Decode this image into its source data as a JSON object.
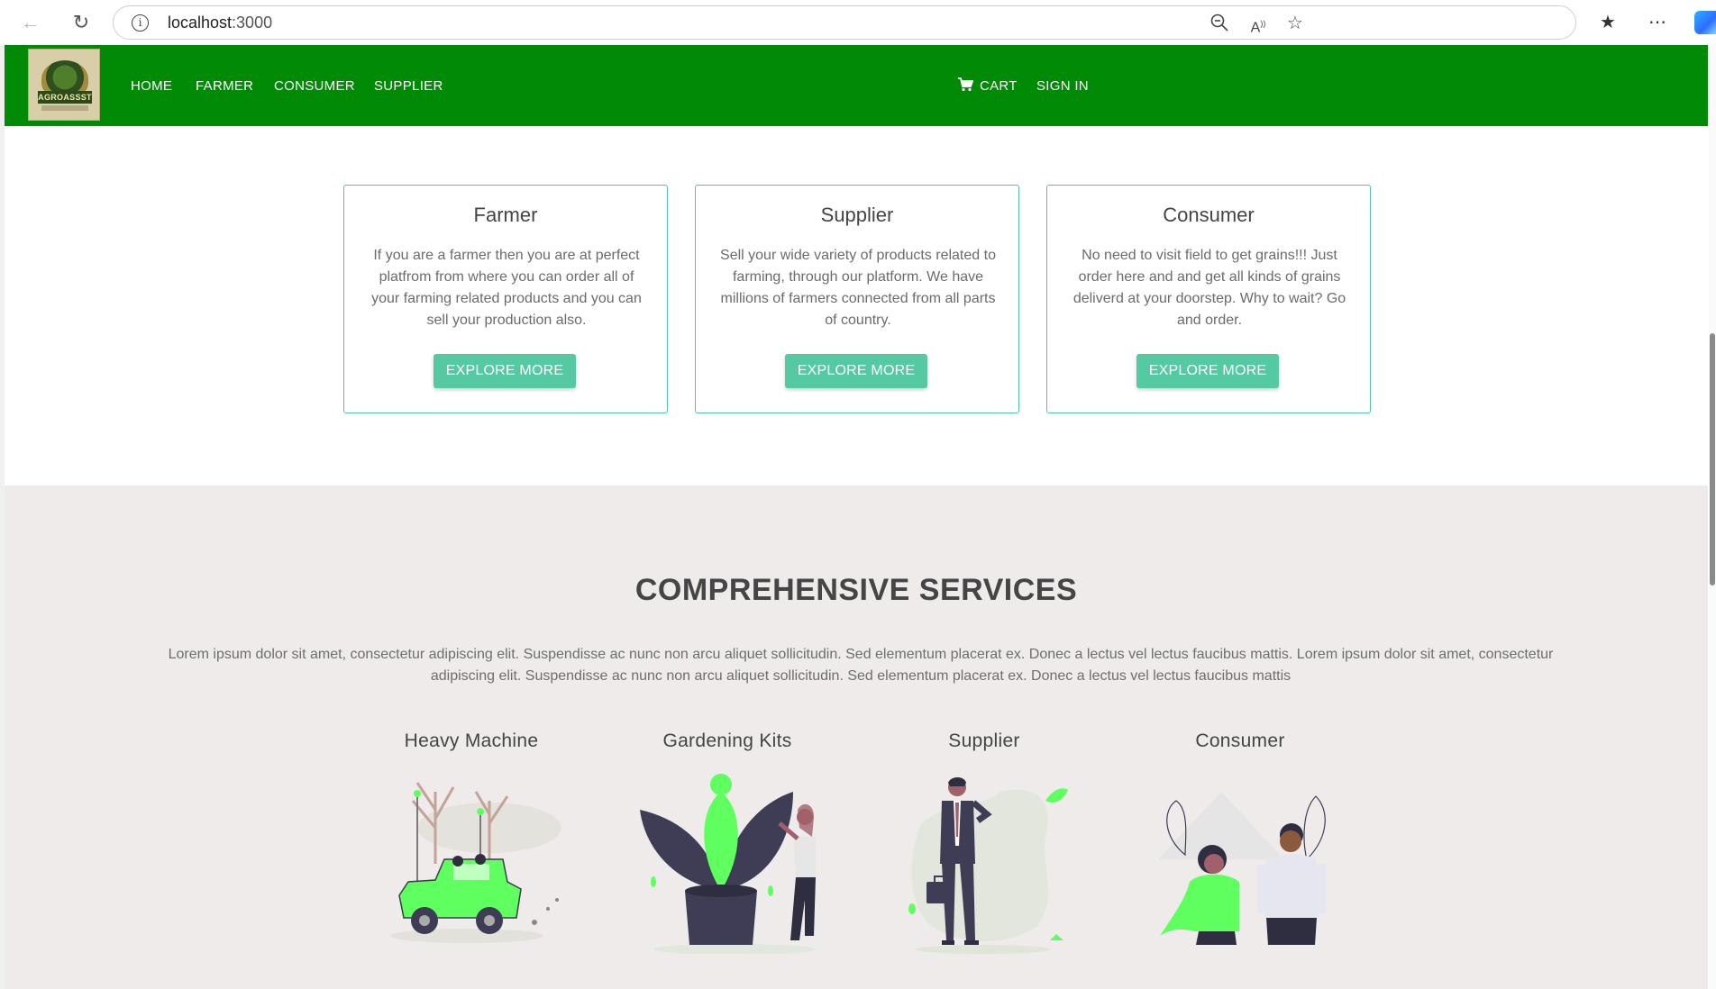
{
  "browser": {
    "url_host": "localhost",
    "url_port": ":3000"
  },
  "navbar": {
    "logo_text": "AGROASSST",
    "links": [
      "HOME",
      "FARMER",
      "CONSUMER",
      "SUPPLIER"
    ],
    "cart_label": "CART",
    "signin_label": "SIGN IN",
    "bg_color": "#008a06"
  },
  "cards": [
    {
      "title": "Farmer",
      "text": "If you are a farmer then you are at perfect platfrom from where you can order all of your farming related products and you can sell your production also.",
      "button": "EXPLORE MORE"
    },
    {
      "title": "Supplier",
      "text": "Sell your wide variety of products related to farming, through our platform. We have millions of farmers connected from all parts of country.",
      "button": "EXPLORE MORE"
    },
    {
      "title": "Consumer",
      "text": "No need to visit field to get grains!!! Just order here and and get all kinds of grains deliverd at your doorstep. Why to wait? Go and order.",
      "button": "EXPLORE MORE"
    }
  ],
  "services": {
    "heading": "COMPREHENSIVE SERVICES",
    "description": "Lorem ipsum dolor sit amet, consectetur adipiscing elit. Suspendisse ac nunc non arcu aliquet sollicitudin. Sed elementum placerat ex. Donec a lectus vel lectus faucibus mattis. Lorem ipsum dolor sit amet, consectetur adipiscing elit. Suspendisse ac nunc non arcu aliquet sollicitudin. Sed elementum placerat ex. Donec a lectus vel lectus faucibus mattis",
    "items": [
      {
        "title": "Heavy Machine",
        "illustration": "jeep-illustration"
      },
      {
        "title": "Gardening Kits",
        "illustration": "plant-illustration"
      },
      {
        "title": "Supplier",
        "illustration": "businessman-illustration"
      },
      {
        "title": "Consumer",
        "illustration": "couple-illustration"
      }
    ],
    "accent_color": "#5fff5f"
  }
}
